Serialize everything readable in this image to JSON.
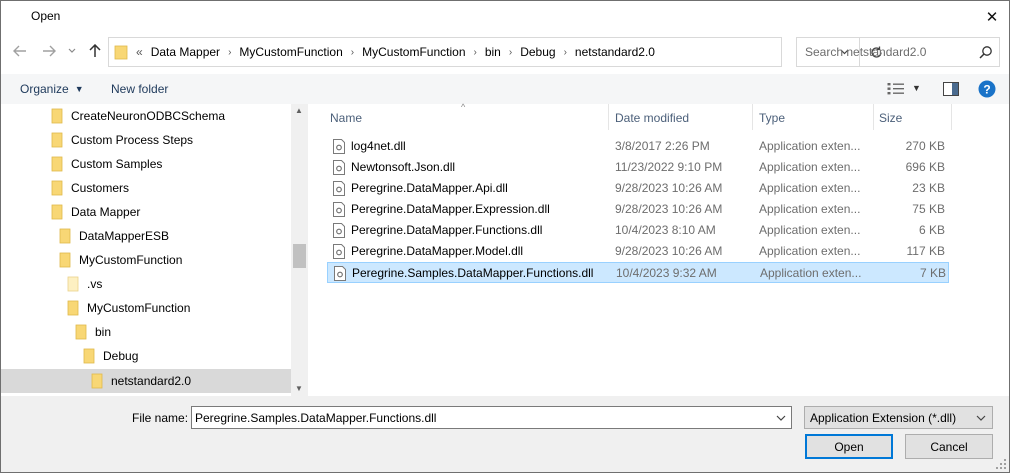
{
  "window": {
    "title": "Open",
    "close_glyph": "✕"
  },
  "address": {
    "lead": "«",
    "crumbs": [
      "Data Mapper",
      "MyCustomFunction",
      "MyCustomFunction",
      "bin",
      "Debug",
      "netstandard2.0"
    ],
    "separator": "›"
  },
  "search": {
    "placeholder": "Search netstandard2.0"
  },
  "toolbar": {
    "organize": "Organize",
    "new_folder": "New folder"
  },
  "nav": {
    "items": [
      {
        "label": "CreateNeuronODBCSchema"
      },
      {
        "label": "Custom Process Steps"
      },
      {
        "label": "Custom Samples"
      },
      {
        "label": "Customers"
      },
      {
        "label": "Data Mapper"
      },
      {
        "label": "DataMapperESB"
      },
      {
        "label": "MyCustomFunction"
      },
      {
        "label": ".vs"
      },
      {
        "label": "MyCustomFunction"
      },
      {
        "label": "bin"
      },
      {
        "label": "Debug"
      },
      {
        "label": "netstandard2.0"
      }
    ]
  },
  "columns": {
    "name": "Name",
    "date": "Date modified",
    "type": "Type",
    "size": "Size"
  },
  "files": [
    {
      "name": "log4net.dll",
      "date": "3/8/2017 2:26 PM",
      "type": "Application exten...",
      "size": "270 KB"
    },
    {
      "name": "Newtonsoft.Json.dll",
      "date": "11/23/2022 9:10 PM",
      "type": "Application exten...",
      "size": "696 KB"
    },
    {
      "name": "Peregrine.DataMapper.Api.dll",
      "date": "9/28/2023 10:26 AM",
      "type": "Application exten...",
      "size": "23 KB"
    },
    {
      "name": "Peregrine.DataMapper.Expression.dll",
      "date": "9/28/2023 10:26 AM",
      "type": "Application exten...",
      "size": "75 KB"
    },
    {
      "name": "Peregrine.DataMapper.Functions.dll",
      "date": "10/4/2023 8:10 AM",
      "type": "Application exten...",
      "size": "6 KB"
    },
    {
      "name": "Peregrine.DataMapper.Model.dll",
      "date": "9/28/2023 10:26 AM",
      "type": "Application exten...",
      "size": "117 KB"
    },
    {
      "name": "Peregrine.Samples.DataMapper.Functions.dll",
      "date": "10/4/2023 9:32 AM",
      "type": "Application exten...",
      "size": "7 KB"
    }
  ],
  "footer": {
    "file_name_label": "File name:",
    "file_name_value": "Peregrine.Samples.DataMapper.Functions.dll",
    "file_type": "Application Extension (*.dll)",
    "open": "Open",
    "cancel": "Cancel"
  },
  "colors": {
    "accent": "#0078d7",
    "selected_row": "#cce8ff",
    "folder": "#f8d775",
    "link": "#1e395b"
  }
}
